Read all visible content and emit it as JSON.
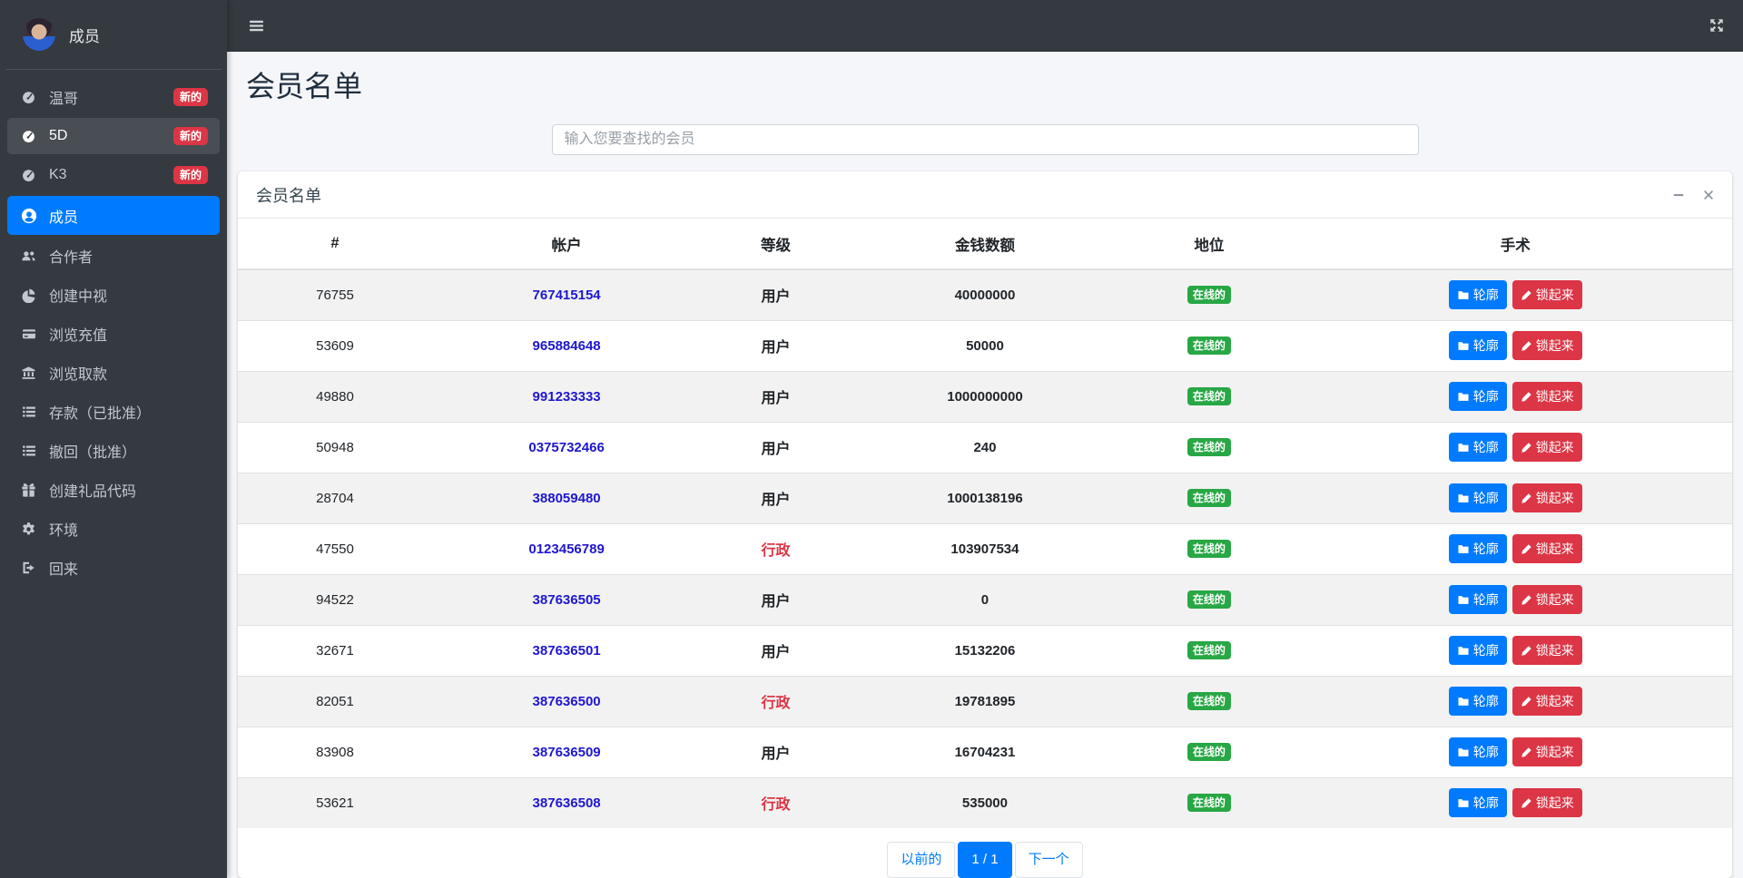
{
  "navbar": {
    "menu_toggle_icon": "bars-icon",
    "fullscreen_icon": "expand-arrows-icon"
  },
  "sidebar": {
    "user_name": "成员",
    "items": [
      {
        "name": "dashboard-wenge",
        "label": "温哥",
        "icon": "tachometer-icon",
        "badge": "新的",
        "state": "default"
      },
      {
        "name": "dashboard-5d",
        "label": "5D",
        "icon": "tachometer-icon",
        "badge": "新的",
        "state": "highlighted"
      },
      {
        "name": "dashboard-k3",
        "label": "K3",
        "icon": "tachometer-icon",
        "badge": "新的",
        "state": "default"
      },
      {
        "name": "members",
        "label": "成员",
        "icon": "user-icon",
        "badge": "",
        "state": "active"
      },
      {
        "name": "partners",
        "label": "合作者",
        "icon": "users-icon",
        "badge": "",
        "state": "default"
      },
      {
        "name": "create-agent-view",
        "label": "创建中视",
        "icon": "pie-chart-icon",
        "badge": "",
        "state": "default"
      },
      {
        "name": "browse-recharge",
        "label": "浏览充值",
        "icon": "credit-card-icon",
        "badge": "",
        "state": "default"
      },
      {
        "name": "browse-withdrawal",
        "label": "浏览取款",
        "icon": "bank-icon",
        "badge": "",
        "state": "default"
      },
      {
        "name": "deposits-approved",
        "label": "存款（已批准）",
        "icon": "list-icon",
        "badge": "",
        "state": "default"
      },
      {
        "name": "withdrawals-approved",
        "label": "撤回（批准）",
        "icon": "list-icon",
        "badge": "",
        "state": "default"
      },
      {
        "name": "create-gift-code",
        "label": "创建礼品代码",
        "icon": "gift-icon",
        "badge": "",
        "state": "default"
      },
      {
        "name": "settings",
        "label": "环境",
        "icon": "gear-icon",
        "badge": "",
        "state": "default"
      },
      {
        "name": "logout",
        "label": "回来",
        "icon": "sign-out-icon",
        "badge": "",
        "state": "default"
      }
    ]
  },
  "page": {
    "title": "会员名单"
  },
  "search": {
    "placeholder": "输入您要查找的会员"
  },
  "panel": {
    "title": "会员名单",
    "minimize_icon": "minus-icon",
    "close_icon": "close-icon"
  },
  "table": {
    "headers": [
      "#",
      "帐户",
      "等级",
      "金钱数额",
      "地位",
      "手术"
    ],
    "row_actions": [
      {
        "label": "轮廓",
        "icon": "folder-icon",
        "style": "primary"
      },
      {
        "label": "锁起来",
        "icon": "pencil-icon",
        "style": "danger"
      }
    ],
    "rows": [
      {
        "id": "76755",
        "account": "767415154",
        "level": "用户",
        "level_type": "user",
        "amount": "40000000",
        "status": "在线的"
      },
      {
        "id": "53609",
        "account": "965884648",
        "level": "用户",
        "level_type": "user",
        "amount": "50000",
        "status": "在线的"
      },
      {
        "id": "49880",
        "account": "991233333",
        "level": "用户",
        "level_type": "user",
        "amount": "1000000000",
        "status": "在线的"
      },
      {
        "id": "50948",
        "account": "0375732466",
        "level": "用户",
        "level_type": "user",
        "amount": "240",
        "status": "在线的"
      },
      {
        "id": "28704",
        "account": "388059480",
        "level": "用户",
        "level_type": "user",
        "amount": "1000138196",
        "status": "在线的"
      },
      {
        "id": "47550",
        "account": "0123456789",
        "level": "行政",
        "level_type": "admin",
        "amount": "103907534",
        "status": "在线的"
      },
      {
        "id": "94522",
        "account": "387636505",
        "level": "用户",
        "level_type": "user",
        "amount": "0",
        "status": "在线的"
      },
      {
        "id": "32671",
        "account": "387636501",
        "level": "用户",
        "level_type": "user",
        "amount": "15132206",
        "status": "在线的"
      },
      {
        "id": "82051",
        "account": "387636500",
        "level": "行政",
        "level_type": "admin",
        "amount": "19781895",
        "status": "在线的"
      },
      {
        "id": "83908",
        "account": "387636509",
        "level": "用户",
        "level_type": "user",
        "amount": "16704231",
        "status": "在线的"
      },
      {
        "id": "53621",
        "account": "387636508",
        "level": "行政",
        "level_type": "admin",
        "amount": "535000",
        "status": "在线的"
      }
    ]
  },
  "pagination": {
    "previous": "以前的",
    "current": "1 / 1",
    "next": "下一个"
  },
  "colors": {
    "sidebar_bg": "#343a40",
    "content_bg": "#f4f6f9",
    "accent_blue": "#007bff",
    "danger_red": "#dc3545",
    "success_green": "#28a745",
    "link_blue": "#1f16cf"
  }
}
